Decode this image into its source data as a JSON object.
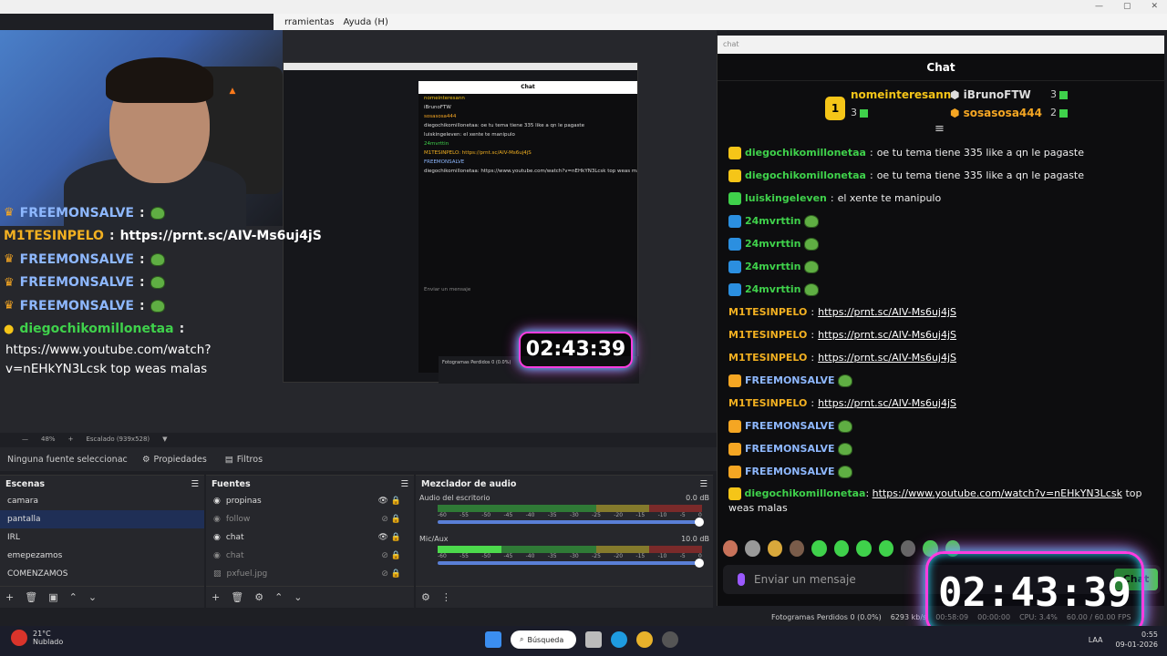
{
  "menubar": {
    "items": [
      "rramientas",
      "Ayuda (H)"
    ]
  },
  "overlay": {
    "rows": [
      {
        "name": "FREEMONSALVE",
        "sep": ":",
        "color": "blue",
        "emote": true
      },
      {
        "name": "M1TESINPELO",
        "sep": ":",
        "color": "yellow",
        "text": "https://prnt.sc/AIV-Ms6uj4jS"
      },
      {
        "name": "FREEMONSALVE",
        "sep": ":",
        "color": "blue",
        "emote": true
      },
      {
        "name": "FREEMONSALVE",
        "sep": ":",
        "color": "blue",
        "emote": true
      },
      {
        "name": "FREEMONSALVE",
        "sep": ":",
        "color": "blue",
        "emote": true
      },
      {
        "name": "diegochikomillonetaa",
        "sep": ":",
        "color": "green"
      }
    ],
    "tail": "https://www.youtube.com/watch?v=nEHkYN3Lcsk top weas malas"
  },
  "nested": {
    "title": "Chat",
    "lines": [
      "nomeinteresann",
      "iBrunoFTW",
      "sosasosa444",
      "diegochikomillonetaa: oe tu tema tiene 335 like a qn le pagaste",
      "luiskingeleven: el xente te manipulo",
      "24mvrttin",
      "M1TESINPELO: https://prnt.sc/AIV-Ms6uj4jS",
      "FREEMONSALVE",
      "diegochikomillonetaa: https://www.youtube.com/watch?v=nEHkYN3Lcsk top weas malas"
    ],
    "timer": "02:43:39",
    "input_placeholder": "Enviar un mensaje",
    "stats": "Fotogramas Perdidos 0 (0.0%)"
  },
  "zoom": {
    "percent": "48%",
    "scale": "Escalado (939x528)"
  },
  "source_bar": {
    "no_source": "Ninguna fuente seleccionac",
    "properties": "Propiedades",
    "filters": "Filtros"
  },
  "scenes": {
    "title": "Escenas",
    "items": [
      "camara",
      "pantalla",
      "IRL",
      "emepezamos",
      "COMENZAMOS"
    ],
    "selected": "pantalla"
  },
  "sources": {
    "title": "Fuentes",
    "items": [
      {
        "label": "propinas",
        "visible": true
      },
      {
        "label": "follow",
        "visible": false
      },
      {
        "label": "chat",
        "visible": true
      },
      {
        "label": "chat",
        "visible": false
      },
      {
        "label": "pxfuel.jpg",
        "visible": false
      }
    ]
  },
  "mixer": {
    "title": "Mezclador de audio",
    "channels": [
      {
        "name": "Audio del escritorio",
        "db": "0.0 dB",
        "level": 0
      },
      {
        "name": "Mic/Aux",
        "db": "10.0 dB",
        "level": 0.24
      }
    ],
    "scale": [
      "-60",
      "-55",
      "-50",
      "-45",
      "-40",
      "-35",
      "-30",
      "-25",
      "-20",
      "-15",
      "-10",
      "-5",
      "0"
    ]
  },
  "status": {
    "dropped": "Fotogramas Perdidos 0 (0.0%)",
    "kbps": "6293 kb/s",
    "time1": "00:58:09",
    "time2": "00:00:00",
    "cpu": "CPU: 3.4%",
    "fps": "60.00 / 60.00 FPS"
  },
  "chat": {
    "window_title": "chat",
    "title": "Chat",
    "leader": {
      "first": {
        "rank": "1",
        "name": "nomeinteresann",
        "count": "3"
      },
      "second": {
        "name": "iBrunoFTW",
        "count": "3"
      },
      "third": {
        "name": "sosasosa444",
        "count": "2"
      }
    },
    "messages": [
      {
        "user": "diegochikomillonetaa",
        "color": "#3fd14b",
        "text": "oe tu tema tiene 335 like a qn le pagaste"
      },
      {
        "user": "diegochikomillonetaa",
        "color": "#3fd14b",
        "text": "oe tu tema tiene 335 like a qn le pagaste"
      },
      {
        "user": "luiskingeleven",
        "color": "#3fd14b",
        "text": "el xente te manipulo"
      },
      {
        "user": "24mvrttin",
        "color": "#3fd14b",
        "emote": true
      },
      {
        "user": "24mvrttin",
        "color": "#3fd14b",
        "emote": true
      },
      {
        "user": "24mvrttin",
        "color": "#3fd14b",
        "emote": true
      },
      {
        "user": "24mvrttin",
        "color": "#3fd14b",
        "emote": true
      },
      {
        "user": "M1TESINPELO",
        "color": "#f2b021",
        "link": "https://prnt.sc/AIV-Ms6uj4jS"
      },
      {
        "user": "M1TESINPELO",
        "color": "#f2b021",
        "link": "https://prnt.sc/AIV-Ms6uj4jS"
      },
      {
        "user": "M1TESINPELO",
        "color": "#f2b021",
        "link": "https://prnt.sc/AIV-Ms6uj4jS"
      },
      {
        "user": "FREEMONSALVE",
        "color": "#8eb8ff",
        "emote": true
      },
      {
        "user": "M1TESINPELO",
        "color": "#f2b021",
        "link": "https://prnt.sc/AIV-Ms6uj4jS"
      },
      {
        "user": "FREEMONSALVE",
        "color": "#8eb8ff",
        "emote": true
      },
      {
        "user": "FREEMONSALVE",
        "color": "#8eb8ff",
        "emote": true
      },
      {
        "user": "FREEMONSALVE",
        "color": "#8eb8ff",
        "emote": true
      }
    ],
    "last": {
      "user": "diegochikomillonetaa",
      "link": "https://www.youtube.com/watch?v=nEHkYN3Lcsk",
      "text": "top weas malas"
    },
    "input_placeholder": "Enviar un mensaje",
    "chat_button": "Chat"
  },
  "timer": "02:43:39",
  "taskbar": {
    "temp": "21°C",
    "weather": "Nublado",
    "search": "Búsqueda",
    "lang": "LAA",
    "time": "0:55",
    "date": "09-01-2026"
  }
}
